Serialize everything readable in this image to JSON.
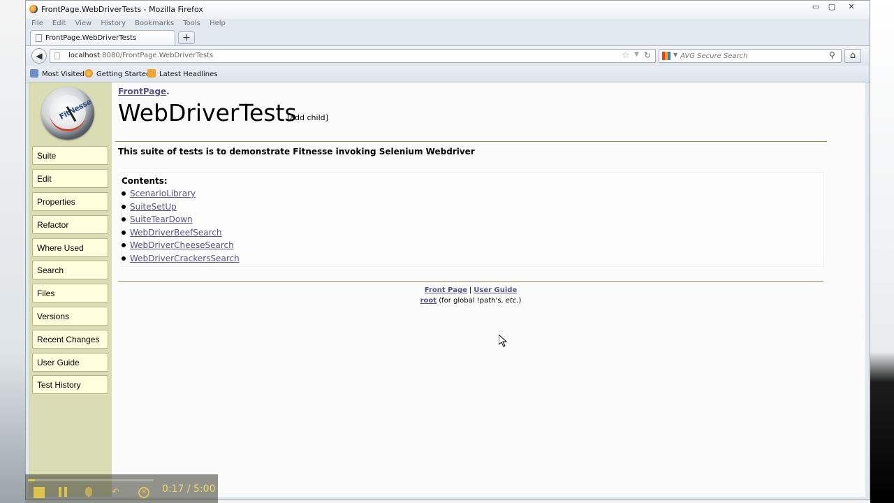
{
  "window": {
    "title": "FrontPage.WebDriverTests - Mozilla Firefox",
    "menu": [
      "File",
      "Edit",
      "View",
      "History",
      "Bookmarks",
      "Tools",
      "Help"
    ],
    "controls": {
      "minimize": "▭",
      "maximize": "▢",
      "close": "✕"
    }
  },
  "tabs": [
    {
      "label": "FrontPage.WebDriverTests",
      "active": true
    }
  ],
  "new_tab_label": "+",
  "navbar": {
    "url_host": "localhost",
    "url_rest": ":8080/FrontPage.WebDriverTests",
    "search_placeholder": "AVG Secure Search",
    "search_icon": "magnifier-icon",
    "back_icon": "back-arrow-icon",
    "home_icon": "home-icon"
  },
  "bookmarks": [
    "Most Visited",
    "Getting Started",
    "Latest Headlines"
  ],
  "sidebar": {
    "logo_text": "FitNesse",
    "items": [
      "Suite",
      "Edit",
      "Properties",
      "Refactor",
      "Where Used",
      "Search",
      "Files",
      "Versions",
      "Recent Changes",
      "User Guide",
      "Test History"
    ]
  },
  "page": {
    "breadcrumb_link": "FrontPage",
    "breadcrumb_suffix": ".",
    "title": "WebDriverTests",
    "add_child": "[add child]",
    "description": "This suite of tests is to demonstrate Fitnesse invoking Selenium Webdriver",
    "contents_label": "Contents:",
    "contents": [
      "ScenarioLibrary",
      "SuiteSetUp",
      "SuiteTearDown",
      "WebDriverBeefSearch",
      "WebDriverCheeseSearch",
      "WebDriverCrackersSearch"
    ]
  },
  "footer": {
    "front_page": "Front Page",
    "separator": "|",
    "user_guide": "User Guide",
    "root": "root",
    "root_note_pre": "(for global !path's, ",
    "root_note_em": "etc.",
    "root_note_post": ")"
  },
  "recorder": {
    "time": "0:17 / 5:00",
    "progress_fraction": 0.057
  },
  "colors": {
    "link": "#535385",
    "sidebar_bg": "#dadcb4",
    "nav_button_bg": "#ffffde",
    "rule": "#a0855b"
  }
}
